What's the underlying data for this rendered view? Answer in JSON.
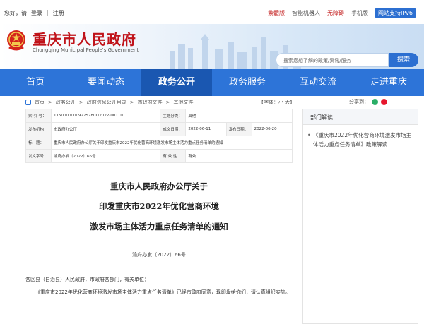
{
  "topbar": {
    "greeting": "您好，请",
    "login": "登录",
    "register": "注册",
    "links": [
      "繁體版",
      "智能机器人",
      "无障碍",
      "手机版"
    ],
    "ipv6": "网站支持IPv6"
  },
  "header": {
    "title": "重庆市人民政府",
    "subtitle": "Chongqing Municipal People's Government",
    "search_placeholder": "搜索您想了解的政策/资讯/服务",
    "search_button": "搜索"
  },
  "nav": {
    "items": [
      "首页",
      "要闻动态",
      "政务公开",
      "政务服务",
      "互动交流",
      "走进重庆"
    ],
    "active_index": 2
  },
  "breadcrumb": {
    "items": [
      "首页",
      "政务公开",
      "政府信息公开目录",
      "市政府文件",
      "其他文件"
    ],
    "separator": ">"
  },
  "font_control": "【字体：小 大】",
  "share_label": "分享到：",
  "meta": {
    "index_label": "索 引 号：",
    "index_value": "11500000009275780L/2022-00110",
    "subject_label": "主题分类：",
    "subject_value": "其他",
    "issuer_label": "发布机构：",
    "issuer_value": "市政府办公厅",
    "created_label": "成文日期：",
    "created_value": "2022-06-11",
    "published_label": "发布日期：",
    "published_value": "2022-06-20",
    "title_label": "标　题：",
    "title_value": "重庆市人民政府办公厅关于印发重庆市2022年优化营商环境激发市场主体活力重点任务清单的通知",
    "docno_label": "发文字号：",
    "docno_value": "渝府办发〔2022〕66号",
    "validity_label": "有 效 性：",
    "validity_value": "有效"
  },
  "article": {
    "title_lines": [
      "重庆市人民政府办公厅关于",
      "印发重庆市2022年优化营商环境",
      "激发市场主体活力重点任务清单的通知"
    ],
    "doc_no": "渝府办发〔2022〕66号",
    "salutation": "各区县（自治县）人民政府，市政府各部门，有关单位：",
    "paragraph": "《重庆市2022年优化营商环境激发市场主体活力重点任务清单》已经市政府同意，现印发给你们，请认真组织实施。"
  },
  "sidebar": {
    "heading": "部门解读",
    "items": [
      "《重庆市2022年优化营商环境激发市场主体活力重点任务清单》政策解读"
    ]
  },
  "colors": {
    "brand_red": "#c0131a",
    "nav_blue": "#2d74d8",
    "nav_active": "#1a57b1"
  }
}
